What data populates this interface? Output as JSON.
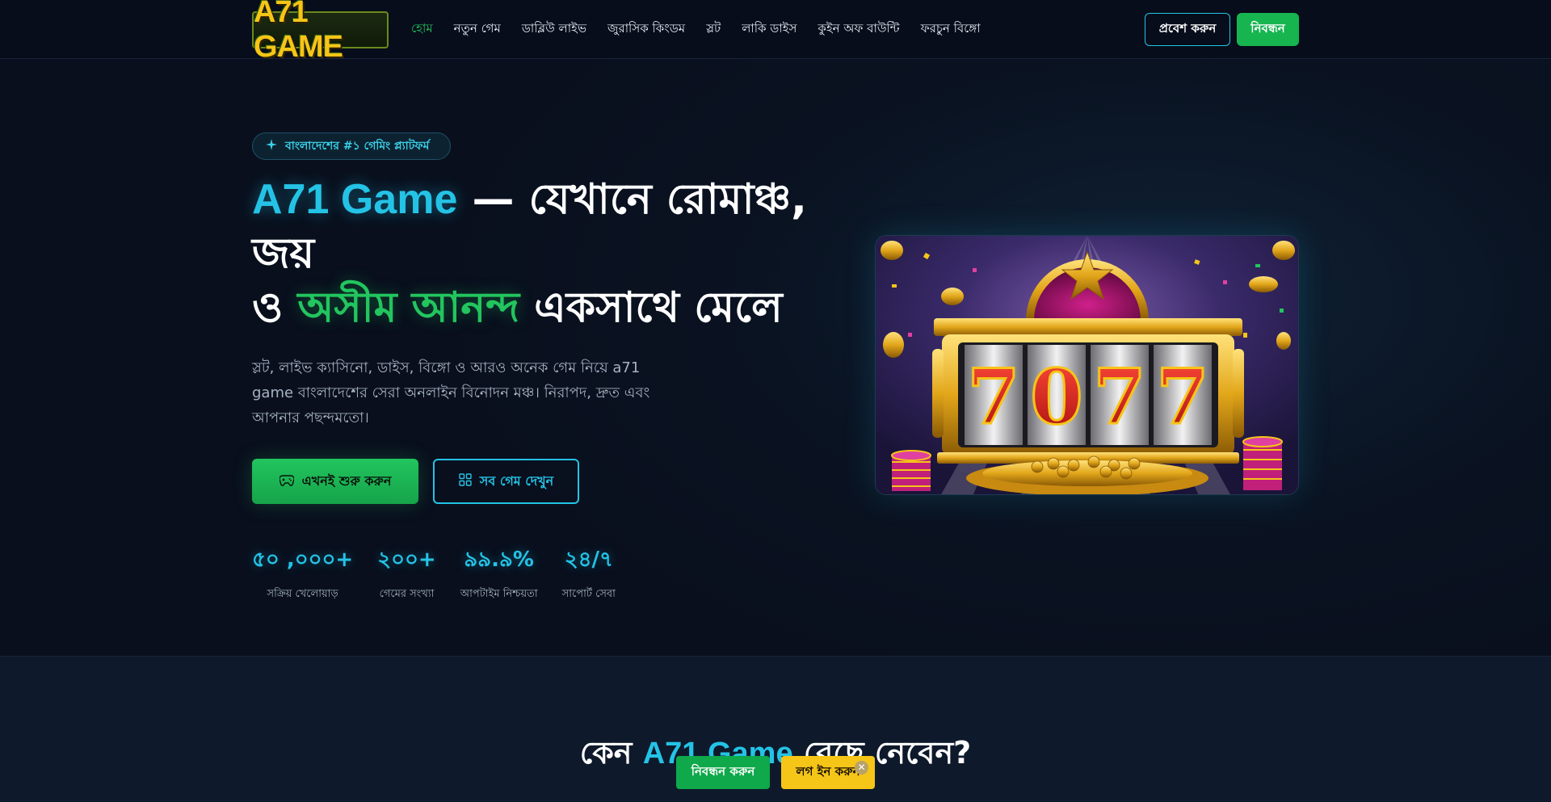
{
  "header": {
    "logo_text": "A71 GAME",
    "nav": [
      {
        "label": "হোম",
        "active": true
      },
      {
        "label": "নতুন গেম"
      },
      {
        "label": "ডাব্লিউ লাইভ"
      },
      {
        "label": "জুরাসিক কিংডম"
      },
      {
        "label": "স্লট"
      },
      {
        "label": "লাকি ডাইস"
      },
      {
        "label": "কুইন অফ বাউন্টি"
      },
      {
        "label": "ফরচুন বিঙ্গো"
      }
    ],
    "login_label": "প্রবেশ করুন",
    "register_label": "নিবন্ধন"
  },
  "hero": {
    "badge_icon": "sparkle-icon",
    "badge_text": "বাংলাদেশের #১ গেমিং প্ল্যাটফর্ম",
    "title_accent1": "A71 Game",
    "title_part1": " — যেখানে রোমাঞ্চ, জয়",
    "title_part2": "ও ",
    "title_accent2": "অসীম আনন্দ",
    "title_part3": " একসাথে মেলে",
    "description": "স্লট, লাইভ ক্যাসিনো, ডাইস, বিঙ্গো ও আরও অনেক গেম নিয়ে a71 game বাংলাদেশের সেরা অনলাইন বিনোদন মঞ্চ। নিরাপদ, দ্রুত এবং আপনার পছন্দমতো।",
    "start_button": "এখনই শুরু করুন",
    "start_icon": "gamepad-icon",
    "games_button": "সব গেম দেখুন",
    "games_icon": "grid-icon",
    "stats": [
      {
        "value": "৫০ ,০০০+",
        "label": "সক্রিয় খেলোয়াড়"
      },
      {
        "value": "২০০+",
        "label": "গেমের সংখ্যা"
      },
      {
        "value": "৯৯.৯%",
        "label": "আপটাইম নিশ্চয়তা"
      },
      {
        "value": "২৪/৭",
        "label": "সাপোর্ট সেবা"
      }
    ],
    "slot_digits": "7077"
  },
  "section2": {
    "title_part1": "কেন ",
    "title_accent": "A71 Game",
    "title_part2": " বেছে নেবেন?"
  },
  "floating": {
    "register_label": "নিবন্ধন করুন",
    "login_label": "লগ ইন করুন",
    "close_symbol": "✕"
  },
  "colors": {
    "accent_cyan": "#24c3e6",
    "accent_green": "#22c55e",
    "gold": "#f5c518",
    "background": "#0a1020"
  }
}
